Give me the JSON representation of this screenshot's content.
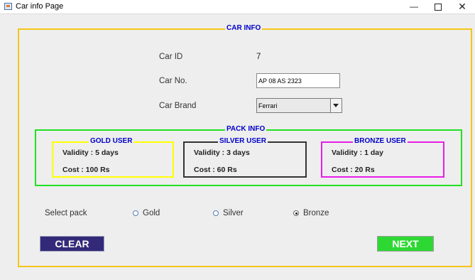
{
  "window": {
    "title": "Car info Page",
    "min_glyph": "—",
    "close_glyph": "✕"
  },
  "car_info": {
    "title": "CAR INFO",
    "car_id_label": "Car ID",
    "car_id_value": "7",
    "car_no_label": "Car No.",
    "car_no_value": "AP 08 AS 2323",
    "car_brand_label": "Car Brand",
    "car_brand_selected": "Ferrari"
  },
  "pack_info": {
    "title": "PACK INFO",
    "packs": [
      {
        "title": "GOLD USER",
        "validity": "Validity : 5 days",
        "cost": "Cost : 100 Rs",
        "color": "#ffff00"
      },
      {
        "title": "SILVER USER",
        "validity": "Validity : 3 days",
        "cost": "Cost : 60 Rs",
        "color": "#333333"
      },
      {
        "title": "BRONZE USER",
        "validity": "Validity : 1 day",
        "cost": "Cost : 20 Rs",
        "color": "#e81ee8"
      }
    ]
  },
  "select_pack": {
    "label": "Select pack",
    "options": [
      {
        "label": "Gold",
        "checked": false
      },
      {
        "label": "Silver",
        "checked": false
      },
      {
        "label": "Bronze",
        "checked": true
      }
    ]
  },
  "buttons": {
    "clear": "CLEAR",
    "next": "NEXT"
  },
  "colors": {
    "title_blue": "#0000c8",
    "car_info_border": "#f5c518",
    "pack_info_border": "#22e022",
    "clear_bg": "#322a78",
    "next_bg": "#2ed833"
  }
}
